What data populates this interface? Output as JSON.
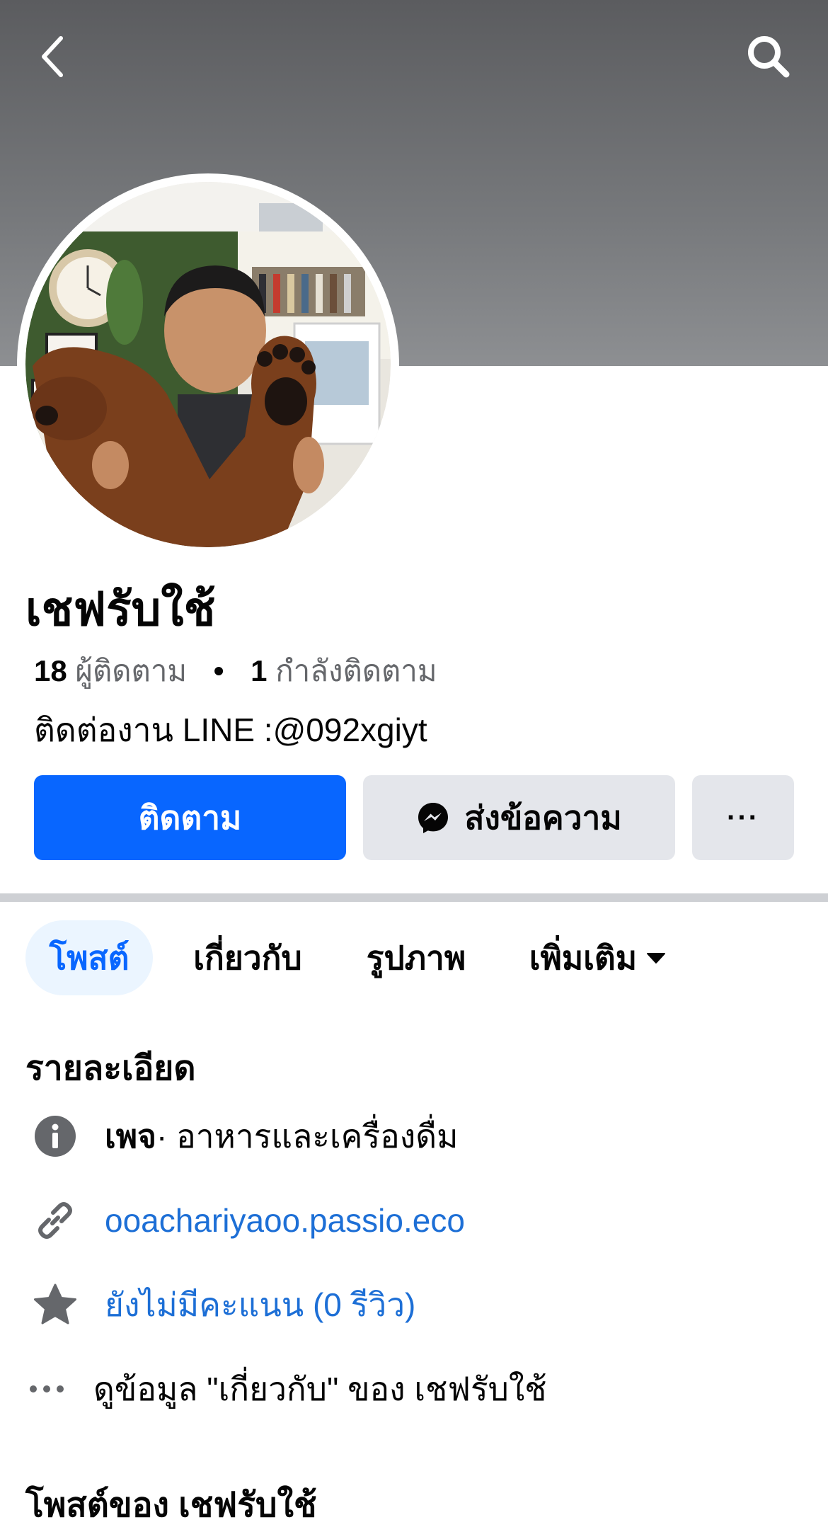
{
  "header": {
    "back_icon": "chevron-left-icon",
    "search_icon": "search-icon"
  },
  "profile": {
    "name": "เชฟรับใช้",
    "followers_count": "18",
    "followers_label": "ผู้ติดตาม",
    "separator": "•",
    "following_count": "1",
    "following_label": "กำลังติดตาม",
    "bio": "ติดต่องาน LINE :@092xgiyt"
  },
  "actions": {
    "follow_label": "ติดตาม",
    "message_label": "ส่งข้อความ",
    "more_label": "···"
  },
  "tabs": [
    {
      "label": "โพสต์",
      "active": true
    },
    {
      "label": "เกี่ยวกับ",
      "active": false
    },
    {
      "label": "รูปภาพ",
      "active": false
    },
    {
      "label": "เพิ่มเติม",
      "active": false
    }
  ],
  "details": {
    "title": "รายละเอียด",
    "category_prefix": "เพจ",
    "category": " · อาหารและเครื่องดื่ม",
    "website": "ooachariyaoo.passio.eco",
    "rating": "ยังไม่มีคะแนน (0 รีวิว)",
    "see_about": "ดูข้อมูล \"เกี่ยวกับ\" ของ เชฟรับใช้"
  },
  "posts": {
    "title": "โพสต์ของ เชฟรับใช้"
  },
  "colors": {
    "accent": "#0866ff",
    "link": "#1d6fd6",
    "button_grey": "#e4e6eb",
    "tab_active_bg": "#ebf5ff"
  }
}
